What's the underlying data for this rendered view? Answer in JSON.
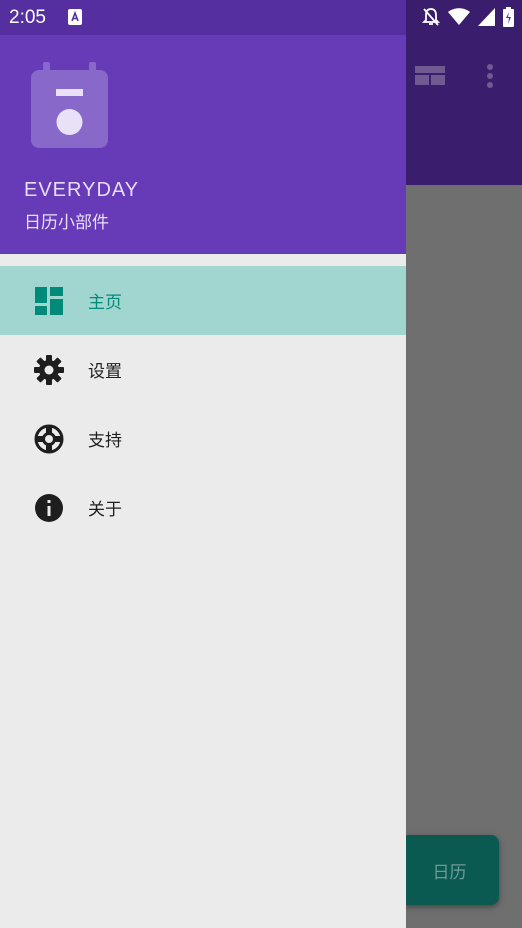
{
  "status_bar": {
    "time": "2:05"
  },
  "drawer": {
    "header": {
      "app_name": "EVERYDAY",
      "subtitle": "日历小部件"
    },
    "menu": [
      {
        "label": "主页",
        "icon": "dashboard-icon",
        "active": true
      },
      {
        "label": "设置",
        "icon": "gear-icon",
        "active": false
      },
      {
        "label": "支持",
        "icon": "lifebuoy-icon",
        "active": false
      },
      {
        "label": "关于",
        "icon": "info-icon",
        "active": false
      }
    ]
  },
  "fab": {
    "label": "日历"
  },
  "colors": {
    "header": "#673ab7",
    "active_item_bg": "#a0d6cf",
    "active_item_text": "#008a7a",
    "drawer_bg": "#ebebeb"
  }
}
